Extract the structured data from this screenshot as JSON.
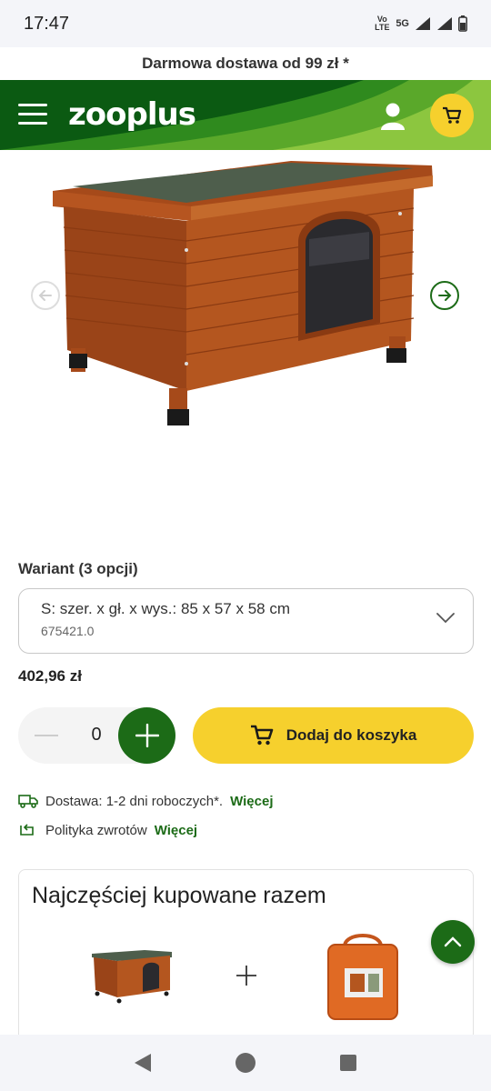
{
  "status_bar": {
    "time": "17:47",
    "volte": "Vo LTE",
    "network": "5G"
  },
  "promo": {
    "text": "Darmowa dostawa od 99 zł *"
  },
  "header": {
    "logo": "zooplus",
    "icons": [
      "hamburger-menu-icon",
      "user-icon",
      "cart-icon"
    ],
    "colors": {
      "brand_green": "#0b5a12",
      "accent_yellow": "#f6d02d"
    }
  },
  "variant": {
    "label": "Wariant (3 opcji)",
    "selected_name": "S: szer. x gł. x wys.: 85 x 57 x 58 cm",
    "selected_code": "675421.0"
  },
  "price": "402,96 zł",
  "quantity": {
    "value": "0"
  },
  "add_to_cart": {
    "label": "Dodaj do koszyka"
  },
  "info": {
    "delivery_text": "Dostawa: 1-2 dni roboczych*.",
    "delivery_link": "Więcej",
    "returns_text": "Polityka zwrotów",
    "returns_link": "Więcej"
  },
  "fbt": {
    "title": "Najczęściej kupowane razem"
  }
}
